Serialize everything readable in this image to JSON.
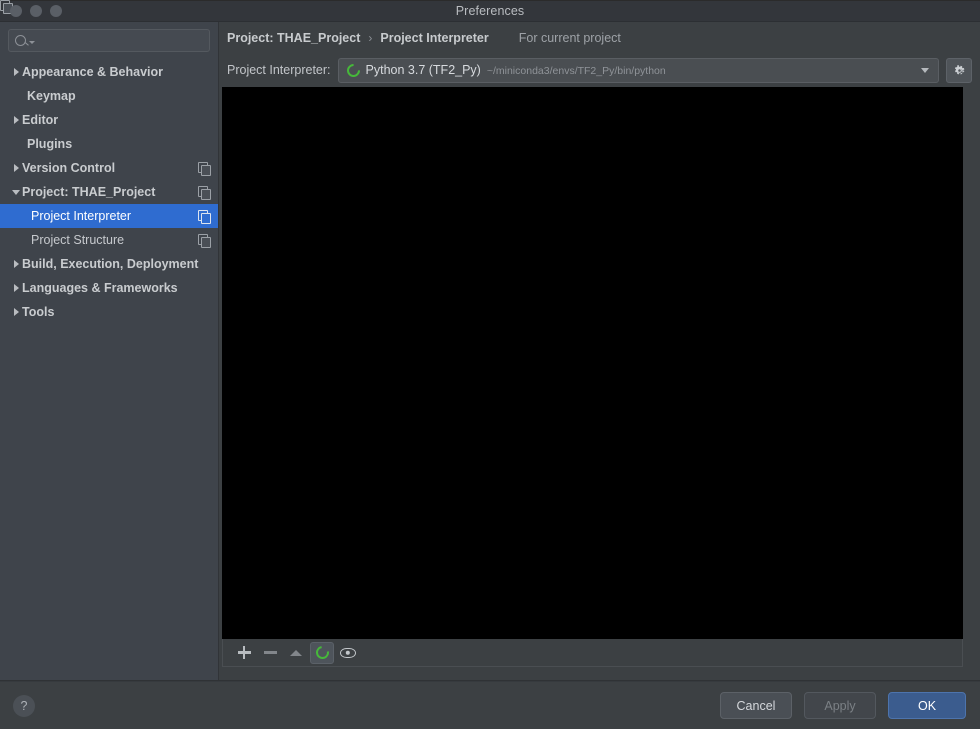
{
  "window": {
    "title": "Preferences",
    "traffic_lights": [
      "close-dot",
      "minimize-dot",
      "maximize-dot"
    ]
  },
  "sidebar": {
    "search": {
      "value": "",
      "placeholder": "",
      "icon": "search-icon",
      "caret": "chevron-down-icon"
    },
    "items": [
      {
        "label": "Appearance & Behavior",
        "depth": 0,
        "expandable": true,
        "expanded": false,
        "bold": true,
        "selected": false,
        "dup_icon": false
      },
      {
        "label": "Keymap",
        "depth": 0,
        "expandable": false,
        "expanded": false,
        "bold": true,
        "selected": false,
        "dup_icon": false
      },
      {
        "label": "Editor",
        "depth": 0,
        "expandable": true,
        "expanded": false,
        "bold": true,
        "selected": false,
        "dup_icon": false
      },
      {
        "label": "Plugins",
        "depth": 0,
        "expandable": false,
        "expanded": false,
        "bold": true,
        "selected": false,
        "dup_icon": false
      },
      {
        "label": "Version Control",
        "depth": 0,
        "expandable": true,
        "expanded": false,
        "bold": true,
        "selected": false,
        "dup_icon": true
      },
      {
        "label": "Project: THAE_Project",
        "depth": 0,
        "expandable": true,
        "expanded": true,
        "bold": true,
        "selected": false,
        "dup_icon": true
      },
      {
        "label": "Project Interpreter",
        "depth": 2,
        "expandable": false,
        "expanded": false,
        "bold": false,
        "selected": true,
        "dup_icon": true
      },
      {
        "label": "Project Structure",
        "depth": 2,
        "expandable": false,
        "expanded": false,
        "bold": false,
        "selected": false,
        "dup_icon": true
      },
      {
        "label": "Build, Execution, Deployment",
        "depth": 0,
        "expandable": true,
        "expanded": false,
        "bold": true,
        "selected": false,
        "dup_icon": false
      },
      {
        "label": "Languages & Frameworks",
        "depth": 0,
        "expandable": true,
        "expanded": false,
        "bold": true,
        "selected": false,
        "dup_icon": false
      },
      {
        "label": "Tools",
        "depth": 0,
        "expandable": true,
        "expanded": false,
        "bold": true,
        "selected": false,
        "dup_icon": false
      }
    ]
  },
  "breadcrumb": {
    "crumb_1": "Project: THAE_Project",
    "separator": "›",
    "crumb_2": "Project Interpreter",
    "for_current_project_label": "For current project",
    "for_current_project_icon": "duplicate-icon"
  },
  "interpreter": {
    "label": "Project Interpreter:",
    "selected_name": "Python 3.7 (TF2_Py)",
    "selected_path": "~/miniconda3/envs/TF2_Py/bin/python",
    "python_icon": "python-conda-icon",
    "dropdown_icon": "chevron-down-icon",
    "gear_icon": "gear-icon"
  },
  "packages": {
    "table_background": "#000000",
    "rows": [],
    "columns": [],
    "toolbar": [
      {
        "name": "install-package-button",
        "icon": "plus-icon",
        "enabled": true,
        "pressed": false
      },
      {
        "name": "uninstall-package-button",
        "icon": "minus-icon",
        "enabled": false,
        "pressed": false
      },
      {
        "name": "upgrade-package-button",
        "icon": "arrow-up-icon",
        "enabled": false,
        "pressed": false
      },
      {
        "name": "loading-indicator",
        "icon": "spinner-icon",
        "enabled": true,
        "pressed": true
      },
      {
        "name": "show-early-releases-button",
        "icon": "eye-icon",
        "enabled": true,
        "pressed": false
      }
    ]
  },
  "footer": {
    "help_label": "?",
    "cancel_label": "Cancel",
    "apply_label": "Apply",
    "apply_enabled": false,
    "ok_label": "OK"
  },
  "colors": {
    "window_bg": "#3c4043",
    "sidebar_bg": "#3f444b",
    "titlebar_bg": "#33363b",
    "selection_blue": "#2f6cd0",
    "primary_button": "#3b5c8e",
    "python_green": "#46b83a",
    "table_bg": "#000000",
    "text_primary": "#c8cbce",
    "text_muted": "#8f9398"
  }
}
